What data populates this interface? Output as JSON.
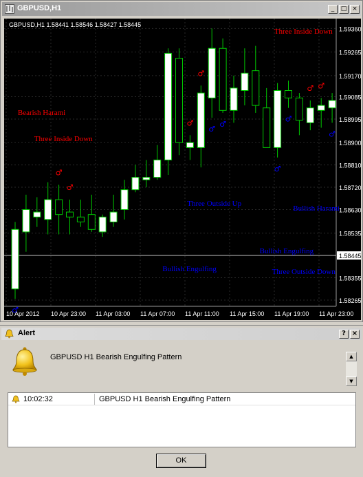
{
  "window": {
    "title": "GBPUSD,H1",
    "buttons": {
      "minimize": "_",
      "restore": "□",
      "close": "×"
    }
  },
  "chart_header": "GBPUSD,H1  1.58441 1.58546 1.58427 1.58445",
  "colors": {
    "bull": "#ffffff",
    "bear": "#000000",
    "candle_stroke": "#00c800",
    "bearish_pattern": "#ff0000",
    "bullish_pattern": "#0000ff",
    "grid": "#2a2a2a",
    "axis_text": "#ffffff"
  },
  "price_axis": [
    "1.59360",
    "1.59265",
    "1.59170",
    "1.59085",
    "1.58995",
    "1.58900",
    "1.58810",
    "1.58720",
    "1.58630",
    "1.58535",
    "1.58355",
    "1.58265"
  ],
  "current_price": "1.58445",
  "time_axis": [
    "10 Apr 2012",
    "10 Apr 23:00",
    "11 Apr 03:00",
    "11 Apr 07:00",
    "11 Apr 11:00",
    "11 Apr 15:00",
    "11 Apr 19:00",
    "11 Apr 23:00"
  ],
  "chart_data": {
    "type": "candlestick",
    "symbol": "GBPUSD",
    "timeframe": "H1",
    "ohlc_header": {
      "open": 1.58441,
      "high": 1.58546,
      "low": 1.58427,
      "close": 1.58445
    },
    "ylim": [
      1.5824,
      1.594
    ],
    "candles": [
      {
        "o": 1.5831,
        "h": 1.5858,
        "l": 1.5827,
        "c": 1.5855
      },
      {
        "o": 1.5854,
        "h": 1.5869,
        "l": 1.5846,
        "c": 1.5863
      },
      {
        "o": 1.586,
        "h": 1.5868,
        "l": 1.5856,
        "c": 1.5862
      },
      {
        "o": 1.5859,
        "h": 1.5874,
        "l": 1.5853,
        "c": 1.5867
      },
      {
        "o": 1.5867,
        "h": 1.5873,
        "l": 1.5853,
        "c": 1.5861
      },
      {
        "o": 1.5862,
        "h": 1.5867,
        "l": 1.5853,
        "c": 1.586
      },
      {
        "o": 1.586,
        "h": 1.5867,
        "l": 1.5856,
        "c": 1.5858
      },
      {
        "o": 1.5861,
        "h": 1.5869,
        "l": 1.5854,
        "c": 1.5855
      },
      {
        "o": 1.5854,
        "h": 1.5861,
        "l": 1.5852,
        "c": 1.586
      },
      {
        "o": 1.5858,
        "h": 1.5869,
        "l": 1.5856,
        "c": 1.5862
      },
      {
        "o": 1.5863,
        "h": 1.5875,
        "l": 1.5859,
        "c": 1.5871
      },
      {
        "o": 1.5871,
        "h": 1.5881,
        "l": 1.587,
        "c": 1.5876
      },
      {
        "o": 1.5875,
        "h": 1.5883,
        "l": 1.5872,
        "c": 1.5876
      },
      {
        "o": 1.5876,
        "h": 1.5889,
        "l": 1.5875,
        "c": 1.5883
      },
      {
        "o": 1.5883,
        "h": 1.5928,
        "l": 1.5877,
        "c": 1.5926
      },
      {
        "o": 1.5924,
        "h": 1.5928,
        "l": 1.5885,
        "c": 1.589
      },
      {
        "o": 1.5888,
        "h": 1.5893,
        "l": 1.5883,
        "c": 1.589
      },
      {
        "o": 1.5888,
        "h": 1.5913,
        "l": 1.588,
        "c": 1.591
      },
      {
        "o": 1.5908,
        "h": 1.5936,
        "l": 1.59,
        "c": 1.5928
      },
      {
        "o": 1.5928,
        "h": 1.5932,
        "l": 1.5902,
        "c": 1.5903
      },
      {
        "o": 1.5903,
        "h": 1.5917,
        "l": 1.5898,
        "c": 1.5912
      },
      {
        "o": 1.5911,
        "h": 1.5928,
        "l": 1.5905,
        "c": 1.5918
      },
      {
        "o": 1.5919,
        "h": 1.5929,
        "l": 1.5902,
        "c": 1.5905
      },
      {
        "o": 1.5904,
        "h": 1.5912,
        "l": 1.589,
        "c": 1.5888
      },
      {
        "o": 1.5888,
        "h": 1.5914,
        "l": 1.5884,
        "c": 1.5911
      },
      {
        "o": 1.5911,
        "h": 1.5915,
        "l": 1.5904,
        "c": 1.5908
      },
      {
        "o": 1.5908,
        "h": 1.591,
        "l": 1.5893,
        "c": 1.5899
      },
      {
        "o": 1.5898,
        "h": 1.5907,
        "l": 1.5895,
        "c": 1.5904
      },
      {
        "o": 1.5903,
        "h": 1.5908,
        "l": 1.5896,
        "c": 1.5905
      },
      {
        "o": 1.5904,
        "h": 1.591,
        "l": 1.5898,
        "c": 1.5907
      }
    ],
    "pattern_labels": {
      "bearish": [
        {
          "text": "Three Inside Down",
          "candle": 27
        },
        {
          "text": "Bearish Harami",
          "candle": 1
        },
        {
          "text": "Three Inside Down",
          "candle": 2
        }
      ],
      "bullish": [
        {
          "text": "Three Outside Up",
          "candle": 17
        },
        {
          "text": "Bullish Harami",
          "candle": 27
        },
        {
          "text": "Bullish Engulfing",
          "candle": 24
        },
        {
          "text": "Bullish Engulfing",
          "candle": 17
        },
        {
          "text": "Three Outside Down",
          "candle": 24
        }
      ]
    },
    "arrows_red": [
      4,
      5,
      16,
      17,
      27,
      28
    ],
    "arrows_blue": [
      0,
      19,
      24,
      25,
      29,
      18
    ]
  },
  "alert": {
    "title": "Alert",
    "help_button": "?",
    "close_button": "×",
    "message": "GBPUSD H1 Bearish Engulfing Pattern",
    "scroll_up": "▲",
    "scroll_down": "▼",
    "log": [
      {
        "time": "10:02:32",
        "message": "GBPUSD H1 Bearish Engulfing Pattern"
      }
    ],
    "ok_label": "OK"
  }
}
